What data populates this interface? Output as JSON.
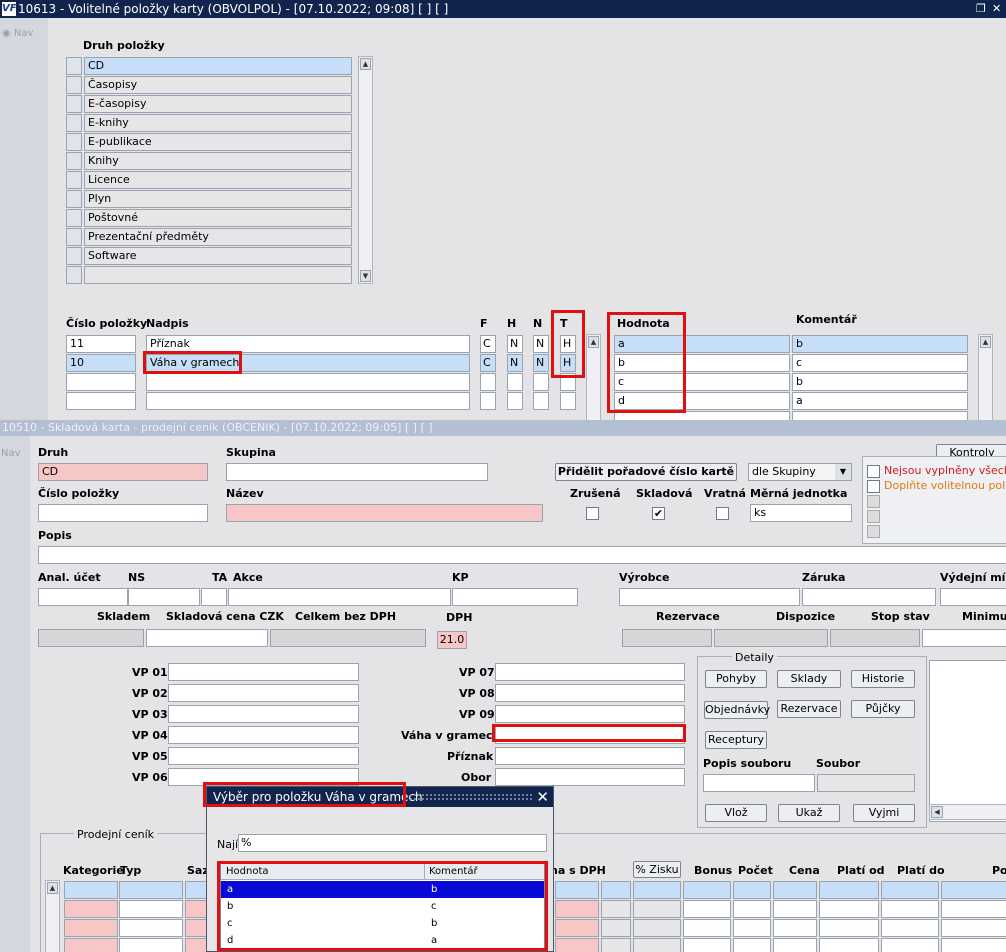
{
  "win1": {
    "title": "10613 - Volitelné položky karty (OBVOLPOL) - [07.10.2022; 09:08]  [ ]  [ ]",
    "logo": "VF",
    "restore_icon": "❐",
    "close_icon": "✕",
    "nav": "Nav",
    "druh_header": "Druh položky",
    "druh_items": [
      "CD",
      "Časopisy",
      "E-časopisy",
      "E-knihy",
      "E-publikace",
      "Knihy",
      "Licence",
      "Plyn",
      "Poštovné",
      "Prezentační předměty",
      "Software",
      ""
    ],
    "cols": {
      "cislo": "Číslo položky",
      "nadpis": "Nadpis",
      "f": "F",
      "h": "H",
      "n": "N",
      "t": "T",
      "hodnota": "Hodnota",
      "komentar": "Komentář"
    },
    "rows": [
      {
        "cislo": "11",
        "nadpis": "Příznak",
        "f": "C",
        "h": "N",
        "n": "N",
        "t": "H"
      },
      {
        "cislo": "10",
        "nadpis": "Váha v gramech",
        "f": "C",
        "h": "N",
        "n": "N",
        "t": "H"
      },
      {
        "cislo": "",
        "nadpis": "",
        "f": "",
        "h": "",
        "n": "",
        "t": ""
      },
      {
        "cislo": "",
        "nadpis": "",
        "f": "",
        "h": "",
        "n": "",
        "t": ""
      }
    ],
    "values": [
      {
        "hodnota": "a",
        "komentar": "b"
      },
      {
        "hodnota": "b",
        "komentar": "c"
      },
      {
        "hodnota": "c",
        "komentar": "b"
      },
      {
        "hodnota": "d",
        "komentar": "a"
      }
    ]
  },
  "win2": {
    "title": "10510 - Skladová karta - prodejní ceník (OBCENIK) - [07.10.2022; 09:05]  [ ]  [ ]",
    "nav": "Nav",
    "labels": {
      "druh": "Druh",
      "skupina": "Skupina",
      "cislo": "Číslo položky",
      "nazev": "Název",
      "popis": "Popis",
      "anal": "Anal. účet",
      "ns": "NS",
      "ta": "TA",
      "akce": "Akce",
      "kp": "KP",
      "vyrobce": "Výrobce",
      "zaruka": "Záruka",
      "vydejni": "Výdejní mís",
      "skladem": "Skladem",
      "skladova_cena": "Skladová cena CZK",
      "celkem": "Celkem bez DPH",
      "dph": "DPH",
      "rezervace": "Rezervace",
      "dispozice": "Dispozice",
      "stop_stav": "Stop stav",
      "minimum": "Minimu",
      "zrusena": "Zrušená",
      "skladova": "Skladová",
      "vratna": "Vratná",
      "merna": "Měrná jednotka",
      "detaily": "Detaily",
      "popis_souboru": "Popis souboru",
      "soubor": "Soubor",
      "prodejni_cenik": "Prodejní ceník",
      "kategorie": "Kategorie",
      "typ": "Typ",
      "sazba": "Sazl",
      "cena_dph": "na s DPH",
      "bonus": "Bonus",
      "pocet": "Počet",
      "cena": "Cena",
      "plati_od": "Platí od",
      "plati_do": "Platí do",
      "po": "Po"
    },
    "values": {
      "druh": "CD",
      "skupina": "",
      "cislo": "",
      "nazev": "",
      "popis": "",
      "dph": "21.0",
      "merna": "ks",
      "dle_skupiny": "dle Skupiny",
      "vaha": ""
    },
    "checks": {
      "zrusena": false,
      "skladova": true,
      "vratna": false
    },
    "buttons": {
      "pridelit": "Přidělit pořadové číslo kartě",
      "kontroly": "Kontroly",
      "pohyby": "Pohyby",
      "sklady": "Sklady",
      "historie": "Historie",
      "objednavky": "Objednávky",
      "rezervace": "Rezervace",
      "pujcky": "Půjčky",
      "receptury": "Receptury",
      "vloz": "Vlož",
      "ukaz": "Ukaž",
      "vyjmi": "Vyjmi",
      "zisku": "% Zisku"
    },
    "warnings": [
      "Nejsou vyplněny všechny",
      "Doplňte volitelnou položku"
    ],
    "vp_labels": [
      "VP 01",
      "VP 02",
      "VP 03",
      "VP 04",
      "VP 05",
      "VP 06",
      "VP 07",
      "VP 08",
      "VP 09",
      "Váha v gramech",
      "Příznak",
      "Obor"
    ]
  },
  "popup": {
    "title": "Výběr pro položku Váha v gramech",
    "close": "✕",
    "find_label": "Najít",
    "find_value": "%",
    "col_hodnota": "Hodnota",
    "col_komentar": "Komentář",
    "rows": [
      {
        "hodnota": "a",
        "komentar": "b"
      },
      {
        "hodnota": "b",
        "komentar": "c"
      },
      {
        "hodnota": "c",
        "komentar": "b"
      },
      {
        "hodnota": "d",
        "komentar": "a"
      }
    ]
  }
}
